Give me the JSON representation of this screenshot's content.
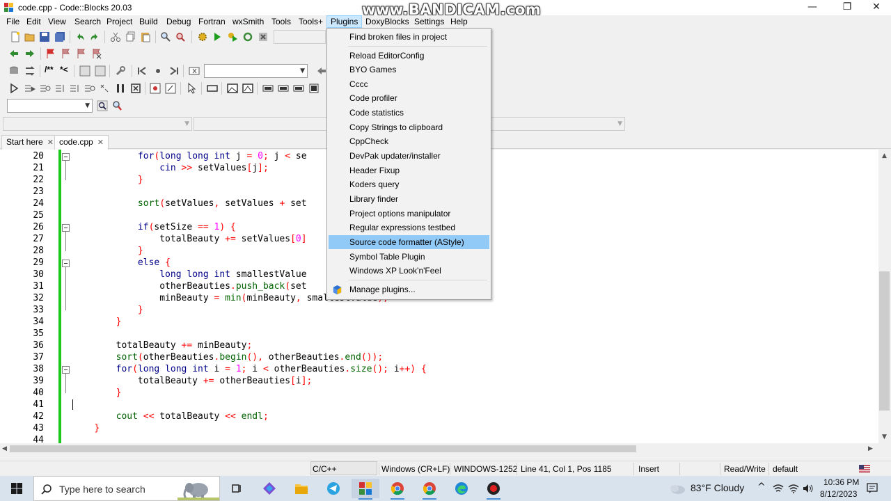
{
  "window": {
    "title": "code.cpp - Code::Blocks 20.03",
    "minimize_glyph": "—",
    "maximize_glyph": "❐",
    "close_glyph": "✕",
    "watermark": "www.BANDICAM.com"
  },
  "menubar": {
    "items": [
      "File",
      "Edit",
      "View",
      "Search",
      "Project",
      "Build",
      "Debug",
      "Fortran",
      "wxSmith",
      "Tools",
      "Tools+",
      "Plugins",
      "DoxyBlocks",
      "Settings",
      "Help"
    ],
    "active": "Plugins"
  },
  "tabs": {
    "start": "Start here",
    "file": "code.cpp",
    "close_glyph": "✕"
  },
  "editor": {
    "lines": [
      {
        "n": "20",
        "fold": true
      },
      {
        "n": "21"
      },
      {
        "n": "22"
      },
      {
        "n": "23"
      },
      {
        "n": "24"
      },
      {
        "n": "25"
      },
      {
        "n": "26",
        "fold": true
      },
      {
        "n": "27"
      },
      {
        "n": "28"
      },
      {
        "n": "29",
        "fold": true
      },
      {
        "n": "30"
      },
      {
        "n": "31"
      },
      {
        "n": "32"
      },
      {
        "n": "33"
      },
      {
        "n": "34"
      },
      {
        "n": "35"
      },
      {
        "n": "36"
      },
      {
        "n": "37"
      },
      {
        "n": "38",
        "fold": true
      },
      {
        "n": "39"
      },
      {
        "n": "40"
      },
      {
        "n": "41"
      },
      {
        "n": "42"
      },
      {
        "n": "43"
      },
      {
        "n": "44"
      }
    ],
    "code": {
      "l20": [
        "            ",
        [
          "kw",
          "for"
        ],
        [
          "op",
          "("
        ],
        [
          "kw",
          "long long int"
        ],
        " j ",
        [
          "op",
          "="
        ],
        " ",
        [
          "num",
          "0"
        ],
        [
          "op",
          ";"
        ],
        " j ",
        [
          "op",
          "<"
        ],
        " se"
      ],
      "l21": [
        "                ",
        [
          "kw",
          "cin"
        ],
        " ",
        [
          "op",
          ">>"
        ],
        " setValues",
        [
          "op",
          "["
        ],
        "j",
        [
          "op",
          "];"
        ]
      ],
      "l22": [
        "            ",
        [
          "op",
          "}"
        ]
      ],
      "l23": [
        ""
      ],
      "l24": [
        "            ",
        [
          "fn",
          "sort"
        ],
        [
          "op",
          "("
        ],
        "setValues",
        [
          "op",
          ","
        ],
        " setValues ",
        [
          "op",
          "+"
        ],
        " set"
      ],
      "l25": [
        ""
      ],
      "l26": [
        "            ",
        [
          "kw",
          "if"
        ],
        [
          "op",
          "("
        ],
        "setSize ",
        [
          "op",
          "=="
        ],
        " ",
        [
          "num",
          "1"
        ],
        [
          "op",
          ")"
        ],
        " ",
        [
          "op",
          "{"
        ]
      ],
      "l27": [
        "                totalBeauty ",
        [
          "op",
          "+="
        ],
        " setValues",
        [
          "op",
          "["
        ],
        [
          "num",
          "0"
        ],
        [
          "op",
          "]"
        ]
      ],
      "l28": [
        "            ",
        [
          "op",
          "}"
        ]
      ],
      "l29": [
        "            ",
        [
          "kw",
          "else"
        ],
        " ",
        [
          "op",
          "{"
        ]
      ],
      "l30": [
        "                ",
        [
          "kw",
          "long long int"
        ],
        " smallestValue"
      ],
      "l31": [
        "                otherBeauties",
        [
          "op",
          "."
        ],
        [
          "fn",
          "push_back"
        ],
        [
          "op",
          "("
        ],
        "set"
      ],
      "l32": [
        "                minBeauty ",
        [
          "op",
          "="
        ],
        " ",
        [
          "fn",
          "min"
        ],
        [
          "op",
          "("
        ],
        "minBeauty",
        [
          "op",
          ","
        ],
        " smallestValue",
        [
          "op",
          ");"
        ]
      ],
      "l33": [
        "            ",
        [
          "op",
          "}"
        ]
      ],
      "l34": [
        "        ",
        [
          "op",
          "}"
        ]
      ],
      "l35": [
        ""
      ],
      "l36": [
        "        totalBeauty ",
        [
          "op",
          "+="
        ],
        " minBeauty",
        [
          "op",
          ";"
        ]
      ],
      "l37": [
        "        ",
        [
          "fn",
          "sort"
        ],
        [
          "op",
          "("
        ],
        "otherBeauties",
        [
          "op",
          "."
        ],
        [
          "fn",
          "begin"
        ],
        [
          "op",
          "(),"
        ],
        " otherBeauties",
        [
          "op",
          "."
        ],
        [
          "fn",
          "end"
        ],
        [
          "op",
          "());"
        ]
      ],
      "l38": [
        "        ",
        [
          "kw",
          "for"
        ],
        [
          "op",
          "("
        ],
        [
          "kw",
          "long long int"
        ],
        " i ",
        [
          "op",
          "="
        ],
        " ",
        [
          "num",
          "1"
        ],
        [
          "op",
          ";"
        ],
        " i ",
        [
          "op",
          "<"
        ],
        " otherBeauties",
        [
          "op",
          "."
        ],
        [
          "fn",
          "size"
        ],
        [
          "op",
          "();"
        ],
        " i",
        [
          "op",
          "++)"
        ],
        " ",
        [
          "op",
          "{"
        ]
      ],
      "l39": [
        "            totalBeauty ",
        [
          "op",
          "+="
        ],
        " otherBeauties",
        [
          "op",
          "["
        ],
        "i",
        [
          "op",
          "];"
        ]
      ],
      "l40": [
        "        ",
        [
          "op",
          "}"
        ]
      ],
      "l41": [
        ""
      ],
      "l42": [
        "        ",
        [
          "fn",
          "cout"
        ],
        " ",
        [
          "op",
          "<<"
        ],
        " totalBeauty ",
        [
          "op",
          "<<"
        ],
        " ",
        [
          "fn",
          "endl"
        ],
        [
          "op",
          ";"
        ]
      ],
      "l43": [
        "    ",
        [
          "op",
          "}"
        ]
      ],
      "l44": [
        ""
      ]
    }
  },
  "plugins_menu": {
    "items": [
      "Find broken files in project",
      "Reload EditorConfig",
      "BYO Games",
      "Cccc",
      "Code profiler",
      "Code statistics",
      "Copy Strings to clipboard",
      "CppCheck",
      "DevPak updater/installer",
      "Header Fixup",
      "Koders query",
      "Library finder",
      "Project options manipulator",
      "Regular expressions testbed",
      "Source code formatter (AStyle)",
      "Symbol Table Plugin",
      "Windows XP Look'n'Feel",
      "Manage plugins..."
    ],
    "highlighted": "Source code formatter (AStyle)"
  },
  "statusbar": {
    "language": "C/C++",
    "eol": "Windows (CR+LF)",
    "encoding": "WINDOWS-1252",
    "position": "Line 41, Col 1, Pos 1185",
    "mode": "Insert",
    "access": "Read/Write",
    "profile": "default"
  },
  "taskbar": {
    "search_placeholder": "Type here to search",
    "weather": "83°F  Cloudy",
    "time": "10:36 PM",
    "date": "8/12/2023"
  },
  "colors": {
    "keyword": "#00008b",
    "operator": "#ff0000",
    "function": "#006400",
    "number": "#ff00ff",
    "change_bar": "#1dc81d",
    "menu_highlight": "#91c9f7",
    "taskbar": "#d9e3ee"
  },
  "icons": [
    "app-logo-icon",
    "new-file-icon",
    "open-icon",
    "save-icon",
    "save-all-icon",
    "undo-icon",
    "redo-icon",
    "cut-icon",
    "copy-icon",
    "paste-icon",
    "find-icon",
    "replace-icon",
    "build-icon",
    "run-icon",
    "build-run-icon",
    "rebuild-icon",
    "abort-icon",
    "bookmark-icon",
    "debug-icon",
    "zoom-icon",
    "windows-start-icon",
    "task-view-icon",
    "edge-icon",
    "explorer-icon",
    "telegram-icon",
    "codeblocks-icon",
    "chrome-icon",
    "record-icon",
    "weather-icon",
    "wifi-icon",
    "speaker-icon",
    "notification-icon",
    "flag-icon"
  ]
}
